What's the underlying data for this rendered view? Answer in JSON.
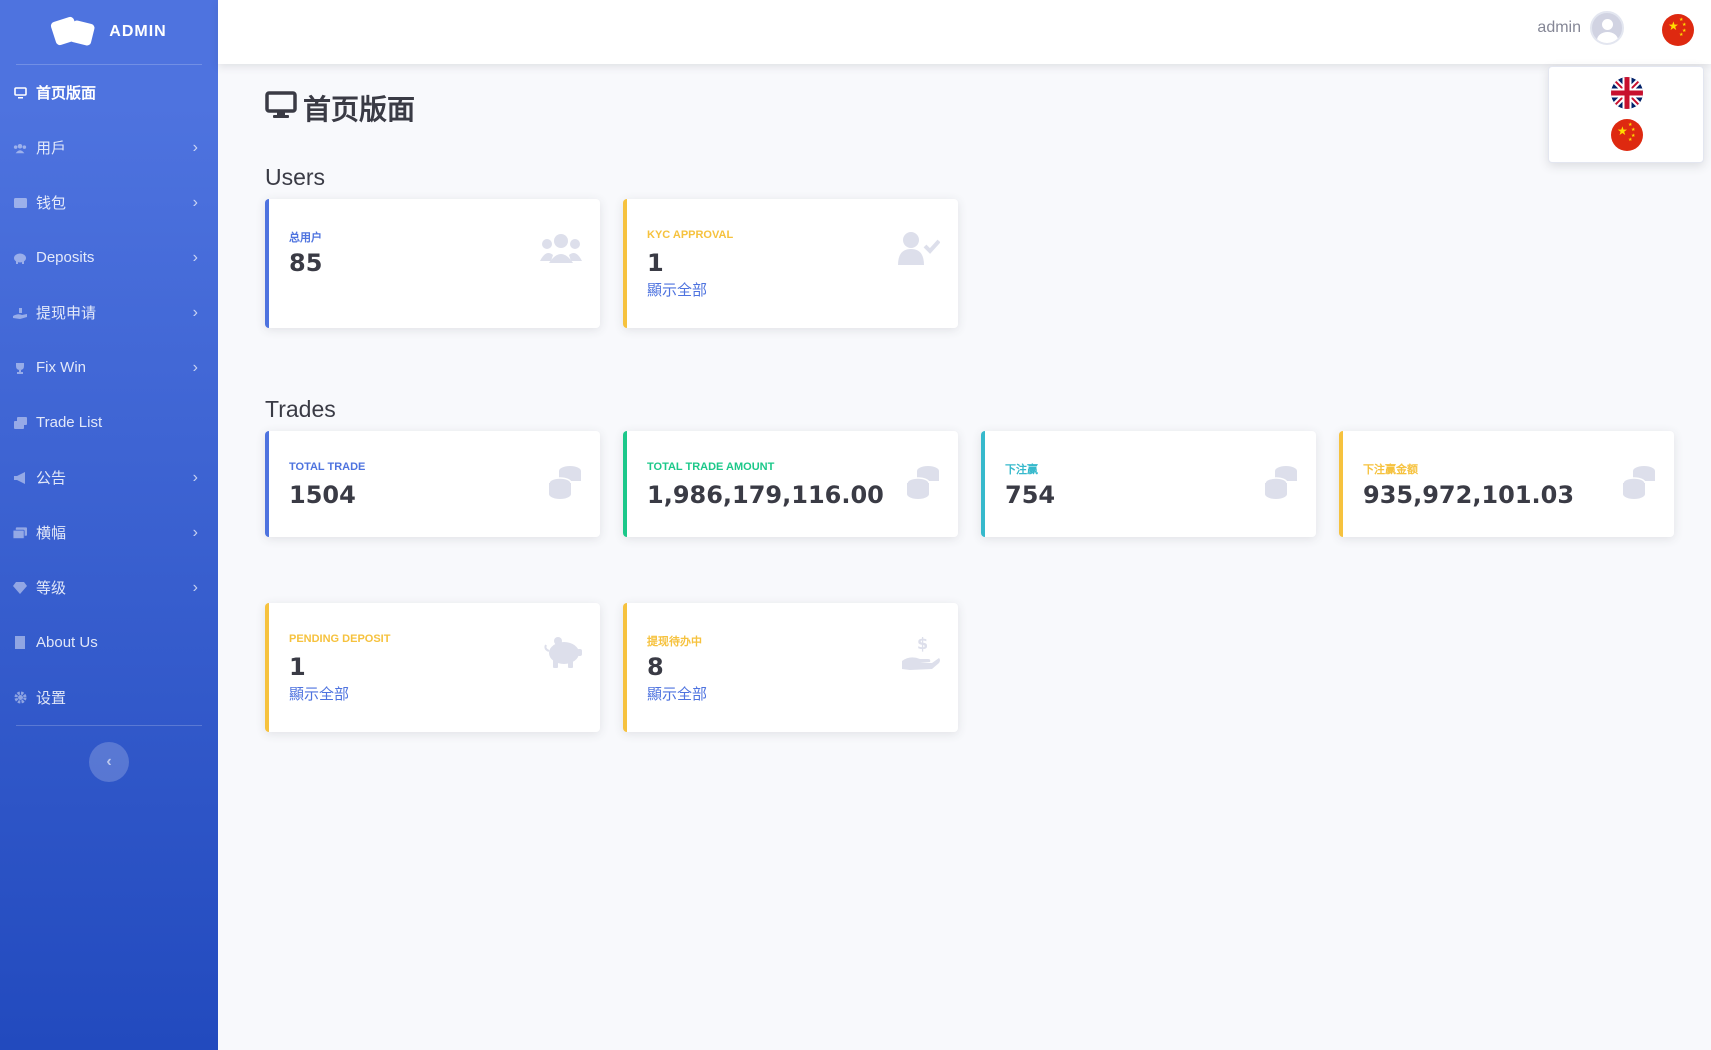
{
  "brand": {
    "name": "ADMIN",
    "icon": "dice-icon"
  },
  "sidebar": {
    "items": [
      {
        "label": "首页版面",
        "icon": "desktop-icon",
        "active": true,
        "has_submenu": false
      },
      {
        "label": "用戶",
        "icon": "users-icon",
        "has_submenu": true
      },
      {
        "label": "钱包",
        "icon": "wallet-icon",
        "has_submenu": true
      },
      {
        "label": "Deposits",
        "icon": "piggy-bank-icon",
        "has_submenu": true
      },
      {
        "label": "提现申请",
        "icon": "hand-holding-usd-icon",
        "has_submenu": true
      },
      {
        "label": "Fix Win",
        "icon": "trophy-icon",
        "has_submenu": true
      },
      {
        "label": "Trade List",
        "icon": "list-icon",
        "has_submenu": false
      },
      {
        "label": "公告",
        "icon": "bullhorn-icon",
        "has_submenu": true
      },
      {
        "label": "横幅",
        "icon": "images-icon",
        "has_submenu": true
      },
      {
        "label": "等级",
        "icon": "gem-icon",
        "has_submenu": true
      },
      {
        "label": "About Us",
        "icon": "building-icon",
        "has_submenu": false
      },
      {
        "label": "设置",
        "icon": "gear-icon",
        "has_submenu": false
      }
    ],
    "toggle_icon": "chevron-left-icon"
  },
  "topbar": {
    "user_name": "admin",
    "current_language": "cn-flag"
  },
  "lang_menu": {
    "options": [
      "uk-flag",
      "cn-flag"
    ]
  },
  "page": {
    "title": "首页版面",
    "title_icon": "desktop-icon",
    "sections": {
      "users": "Users",
      "trades": "Trades"
    }
  },
  "cards": {
    "total_users": {
      "label": "总用户",
      "value": "85",
      "icon": "users-icon",
      "color": "#4e73df"
    },
    "kyc_approval": {
      "label": "KYC APPROVAL",
      "value": "1",
      "link": "顯示全部",
      "icon": "user-check-icon",
      "color": "#f6c23e"
    },
    "total_trade": {
      "label": "TOTAL TRADE",
      "value": "1504",
      "icon": "coins-icon",
      "color": "#4e73df"
    },
    "total_trade_amount": {
      "label": "TOTAL TRADE AMOUNT",
      "value": "1,986,179,116.00",
      "icon": "coins-icon",
      "color": "#1cc88a"
    },
    "bet_wins": {
      "label": "下注赢",
      "value": "754",
      "icon": "coins-icon",
      "color": "#36b9cc"
    },
    "bet_win_amount": {
      "label": "下注赢金额",
      "value": "935,972,101.03",
      "icon": "coins-icon",
      "color": "#f6c23e"
    },
    "pending_deposit": {
      "label": "PENDING DEPOSIT",
      "value": "1",
      "link": "顯示全部",
      "icon": "piggy-bank-icon",
      "color": "#f6c23e"
    },
    "pending_withdrawal": {
      "label": "提现待办中",
      "value": "8",
      "link": "顯示全部",
      "icon": "hand-holding-usd-icon",
      "color": "#f6c23e"
    }
  }
}
